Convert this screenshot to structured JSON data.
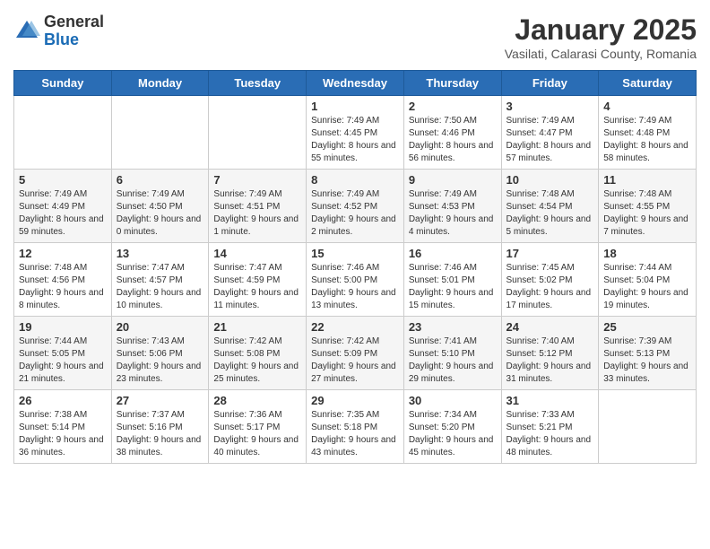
{
  "logo": {
    "general": "General",
    "blue": "Blue"
  },
  "header": {
    "month_title": "January 2025",
    "subtitle": "Vasilati, Calarasi County, Romania"
  },
  "weekdays": [
    "Sunday",
    "Monday",
    "Tuesday",
    "Wednesday",
    "Thursday",
    "Friday",
    "Saturday"
  ],
  "weeks": [
    [
      {
        "day": "",
        "info": ""
      },
      {
        "day": "",
        "info": ""
      },
      {
        "day": "",
        "info": ""
      },
      {
        "day": "1",
        "info": "Sunrise: 7:49 AM\nSunset: 4:45 PM\nDaylight: 8 hours and 55 minutes."
      },
      {
        "day": "2",
        "info": "Sunrise: 7:50 AM\nSunset: 4:46 PM\nDaylight: 8 hours and 56 minutes."
      },
      {
        "day": "3",
        "info": "Sunrise: 7:49 AM\nSunset: 4:47 PM\nDaylight: 8 hours and 57 minutes."
      },
      {
        "day": "4",
        "info": "Sunrise: 7:49 AM\nSunset: 4:48 PM\nDaylight: 8 hours and 58 minutes."
      }
    ],
    [
      {
        "day": "5",
        "info": "Sunrise: 7:49 AM\nSunset: 4:49 PM\nDaylight: 8 hours and 59 minutes."
      },
      {
        "day": "6",
        "info": "Sunrise: 7:49 AM\nSunset: 4:50 PM\nDaylight: 9 hours and 0 minutes."
      },
      {
        "day": "7",
        "info": "Sunrise: 7:49 AM\nSunset: 4:51 PM\nDaylight: 9 hours and 1 minute."
      },
      {
        "day": "8",
        "info": "Sunrise: 7:49 AM\nSunset: 4:52 PM\nDaylight: 9 hours and 2 minutes."
      },
      {
        "day": "9",
        "info": "Sunrise: 7:49 AM\nSunset: 4:53 PM\nDaylight: 9 hours and 4 minutes."
      },
      {
        "day": "10",
        "info": "Sunrise: 7:48 AM\nSunset: 4:54 PM\nDaylight: 9 hours and 5 minutes."
      },
      {
        "day": "11",
        "info": "Sunrise: 7:48 AM\nSunset: 4:55 PM\nDaylight: 9 hours and 7 minutes."
      }
    ],
    [
      {
        "day": "12",
        "info": "Sunrise: 7:48 AM\nSunset: 4:56 PM\nDaylight: 9 hours and 8 minutes."
      },
      {
        "day": "13",
        "info": "Sunrise: 7:47 AM\nSunset: 4:57 PM\nDaylight: 9 hours and 10 minutes."
      },
      {
        "day": "14",
        "info": "Sunrise: 7:47 AM\nSunset: 4:59 PM\nDaylight: 9 hours and 11 minutes."
      },
      {
        "day": "15",
        "info": "Sunrise: 7:46 AM\nSunset: 5:00 PM\nDaylight: 9 hours and 13 minutes."
      },
      {
        "day": "16",
        "info": "Sunrise: 7:46 AM\nSunset: 5:01 PM\nDaylight: 9 hours and 15 minutes."
      },
      {
        "day": "17",
        "info": "Sunrise: 7:45 AM\nSunset: 5:02 PM\nDaylight: 9 hours and 17 minutes."
      },
      {
        "day": "18",
        "info": "Sunrise: 7:44 AM\nSunset: 5:04 PM\nDaylight: 9 hours and 19 minutes."
      }
    ],
    [
      {
        "day": "19",
        "info": "Sunrise: 7:44 AM\nSunset: 5:05 PM\nDaylight: 9 hours and 21 minutes."
      },
      {
        "day": "20",
        "info": "Sunrise: 7:43 AM\nSunset: 5:06 PM\nDaylight: 9 hours and 23 minutes."
      },
      {
        "day": "21",
        "info": "Sunrise: 7:42 AM\nSunset: 5:08 PM\nDaylight: 9 hours and 25 minutes."
      },
      {
        "day": "22",
        "info": "Sunrise: 7:42 AM\nSunset: 5:09 PM\nDaylight: 9 hours and 27 minutes."
      },
      {
        "day": "23",
        "info": "Sunrise: 7:41 AM\nSunset: 5:10 PM\nDaylight: 9 hours and 29 minutes."
      },
      {
        "day": "24",
        "info": "Sunrise: 7:40 AM\nSunset: 5:12 PM\nDaylight: 9 hours and 31 minutes."
      },
      {
        "day": "25",
        "info": "Sunrise: 7:39 AM\nSunset: 5:13 PM\nDaylight: 9 hours and 33 minutes."
      }
    ],
    [
      {
        "day": "26",
        "info": "Sunrise: 7:38 AM\nSunset: 5:14 PM\nDaylight: 9 hours and 36 minutes."
      },
      {
        "day": "27",
        "info": "Sunrise: 7:37 AM\nSunset: 5:16 PM\nDaylight: 9 hours and 38 minutes."
      },
      {
        "day": "28",
        "info": "Sunrise: 7:36 AM\nSunset: 5:17 PM\nDaylight: 9 hours and 40 minutes."
      },
      {
        "day": "29",
        "info": "Sunrise: 7:35 AM\nSunset: 5:18 PM\nDaylight: 9 hours and 43 minutes."
      },
      {
        "day": "30",
        "info": "Sunrise: 7:34 AM\nSunset: 5:20 PM\nDaylight: 9 hours and 45 minutes."
      },
      {
        "day": "31",
        "info": "Sunrise: 7:33 AM\nSunset: 5:21 PM\nDaylight: 9 hours and 48 minutes."
      },
      {
        "day": "",
        "info": ""
      }
    ]
  ]
}
